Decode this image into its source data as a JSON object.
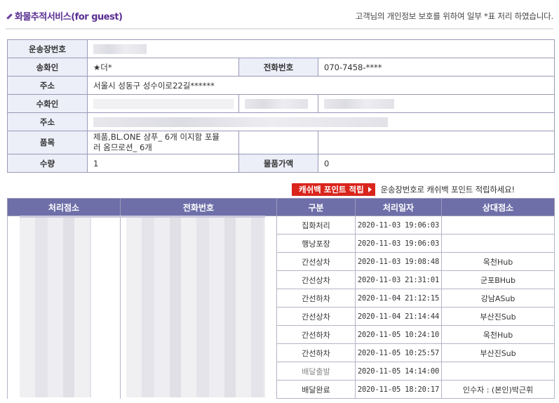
{
  "header": {
    "title_kr": "화물추적서비스",
    "title_en": "(for guest)",
    "notice": "고객님의 개인정보 보호를 위하여 일부 *표 처리 하였습니다."
  },
  "info": {
    "waybill_label": "운송장번호",
    "sender_label": "송화인",
    "sender_value": "★더*",
    "phone_label": "전화번호",
    "sender_phone": "070-7458-****",
    "address_label": "주소",
    "sender_address": "서울시 성동구 성수이로22길******",
    "receiver_label": "수화인",
    "receiver_address_label": "주소",
    "item_label": "품목",
    "item_value_line1": "제품,BL.ONE 샴푸_ 6개 이지함 포뮬",
    "item_value_line2": "러 옴므로션_ 6개",
    "quantity_label": "수량",
    "quantity_value": "1",
    "value_label": "물품가액",
    "value_value": "0"
  },
  "cashback": {
    "button_label": "캐쉬백 포인트 적립",
    "message": "운송장번호로 캐쉬백 포인트 적립하세요!"
  },
  "tracking": {
    "headers": [
      "처리점소",
      "전화번호",
      "구분",
      "처리일자",
      "상대점소"
    ],
    "rows": [
      {
        "status": "집화처리",
        "datetime": "2020-11-03 19:06:03",
        "partner": ""
      },
      {
        "status": "행낭포장",
        "datetime": "2020-11-03 19:06:03",
        "partner": ""
      },
      {
        "status": "간선상차",
        "datetime": "2020-11-03 19:08:48",
        "partner": "옥천Hub"
      },
      {
        "status": "간선상차",
        "datetime": "2020-11-03 21:31:01",
        "partner": "군포BHub"
      },
      {
        "status": "간선하차",
        "datetime": "2020-11-04 21:12:15",
        "partner": "강남ASub"
      },
      {
        "status": "간선상차",
        "datetime": "2020-11-04 21:14:44",
        "partner": "부산진Sub"
      },
      {
        "status": "간선하차",
        "datetime": "2020-11-05 10:24:10",
        "partner": "옥천Hub"
      },
      {
        "status": "간선하차",
        "datetime": "2020-11-05 10:25:57",
        "partner": "부산진Sub"
      },
      {
        "status": "배달출발",
        "datetime": "2020-11-05 14:14:00",
        "partner": ""
      },
      {
        "status": "배달완료",
        "datetime": "2020-11-05 18:20:17",
        "partner": "인수자 : (본인)박근휘"
      }
    ]
  },
  "colors": {
    "title": "#5a2f92",
    "label_bg": "#eceef8",
    "table_header_bg": "#6e6fa8",
    "cashback_red": "#d9251c"
  }
}
